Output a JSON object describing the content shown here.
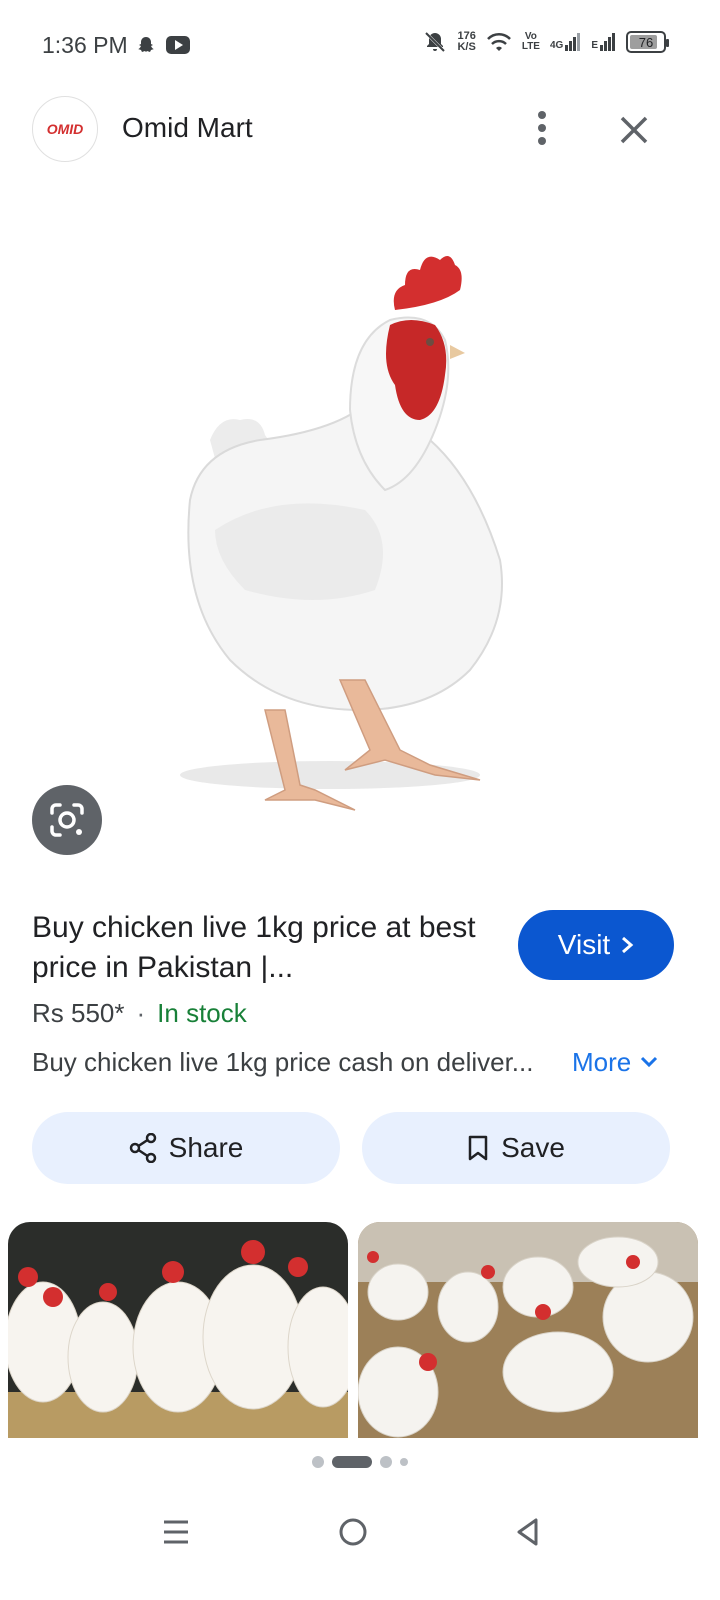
{
  "status_bar": {
    "time": "1:36 PM",
    "net_speed_value": "176",
    "net_speed_unit": "K/S",
    "volte_top": "Vo",
    "volte_bottom": "LTE",
    "net_4g": "4G",
    "net_e": "E",
    "battery": "76",
    "icons": [
      "snapchat-icon",
      "youtube-icon",
      "mute-icon",
      "wifi-icon",
      "signal-icon",
      "battery-icon"
    ]
  },
  "header": {
    "site_name": "Omid Mart",
    "logo_text": "OMID"
  },
  "result": {
    "title": "Buy chicken live 1kg price at best price in Pakistan |...",
    "visit_label": "Visit",
    "price": "Rs 550*",
    "separator": "·",
    "stock": "In stock",
    "description": "Buy chicken live 1kg price cash on deliver...",
    "more_label": "More"
  },
  "actions": {
    "share_label": "Share",
    "save_label": "Save"
  },
  "pagination": {
    "count": 4,
    "active_index": 1
  },
  "colors": {
    "accent": "#0b57d0",
    "pill_bg": "#e8f0fe",
    "stock_green": "#188038",
    "link_blue": "#1a73e8"
  }
}
